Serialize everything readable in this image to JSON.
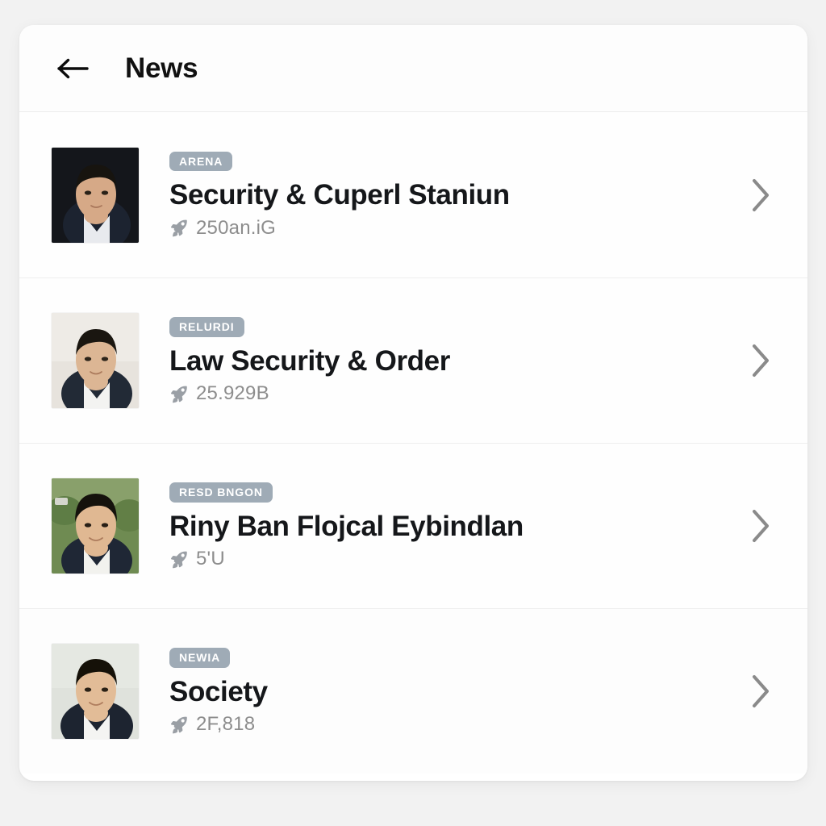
{
  "theme": {
    "page_background": "#f2f2f2",
    "card_background": "#ffffff",
    "badge_background": "#9fabb6",
    "badge_text_color": "#ffffff",
    "title_color": "#15171a",
    "meta_color": "#8d8d8d",
    "chevron_color": "#8a8a8a",
    "divider_color": "#eeeeee"
  },
  "header": {
    "title": "News",
    "back_icon": "arrow-left-icon"
  },
  "list": {
    "items": [
      {
        "badge": "ARENA",
        "title": "Security & Cuperl Staniun",
        "meta": "250an.iG",
        "meta_icon": "rocket-icon",
        "chevron_icon": "chevron-right-icon",
        "thumbnail": {
          "type": "portrait-photo",
          "background": "#171a1f",
          "skin": "#d6a987",
          "hair": "#17140f",
          "suit": "#1c2330",
          "shirt": "#e8eaee"
        }
      },
      {
        "badge": "RELURDI",
        "title": "Law Security & Order",
        "meta": "25.929B",
        "meta_icon": "rocket-icon",
        "chevron_icon": "chevron-right-icon",
        "thumbnail": {
          "type": "portrait-photo",
          "background": "#e7e3dd",
          "skin": "#dcb694",
          "hair": "#1a1610",
          "suit": "#222a36",
          "shirt": "#f3f3f1"
        }
      },
      {
        "badge": "RESD BNGON",
        "title": "Riny Ban Flojcal Eybindlan",
        "meta": "5'U",
        "meta_icon": "rocket-icon",
        "chevron_icon": "chevron-right-icon",
        "thumbnail": {
          "type": "portrait-photo",
          "background": "#6f8b52",
          "skin": "#e0b892",
          "hair": "#15120c",
          "suit": "#1f2735",
          "shirt": "#f2f2ee"
        }
      },
      {
        "badge": "NEWIA",
        "title": "Society",
        "meta": "2F,818",
        "meta_icon": "rocket-icon",
        "chevron_icon": "chevron-right-icon",
        "thumbnail": {
          "type": "portrait-photo",
          "background": "#dfe2dc",
          "skin": "#e2bc97",
          "hair": "#151108",
          "suit": "#1d2430",
          "shirt": "#f4f4f2"
        }
      }
    ]
  }
}
